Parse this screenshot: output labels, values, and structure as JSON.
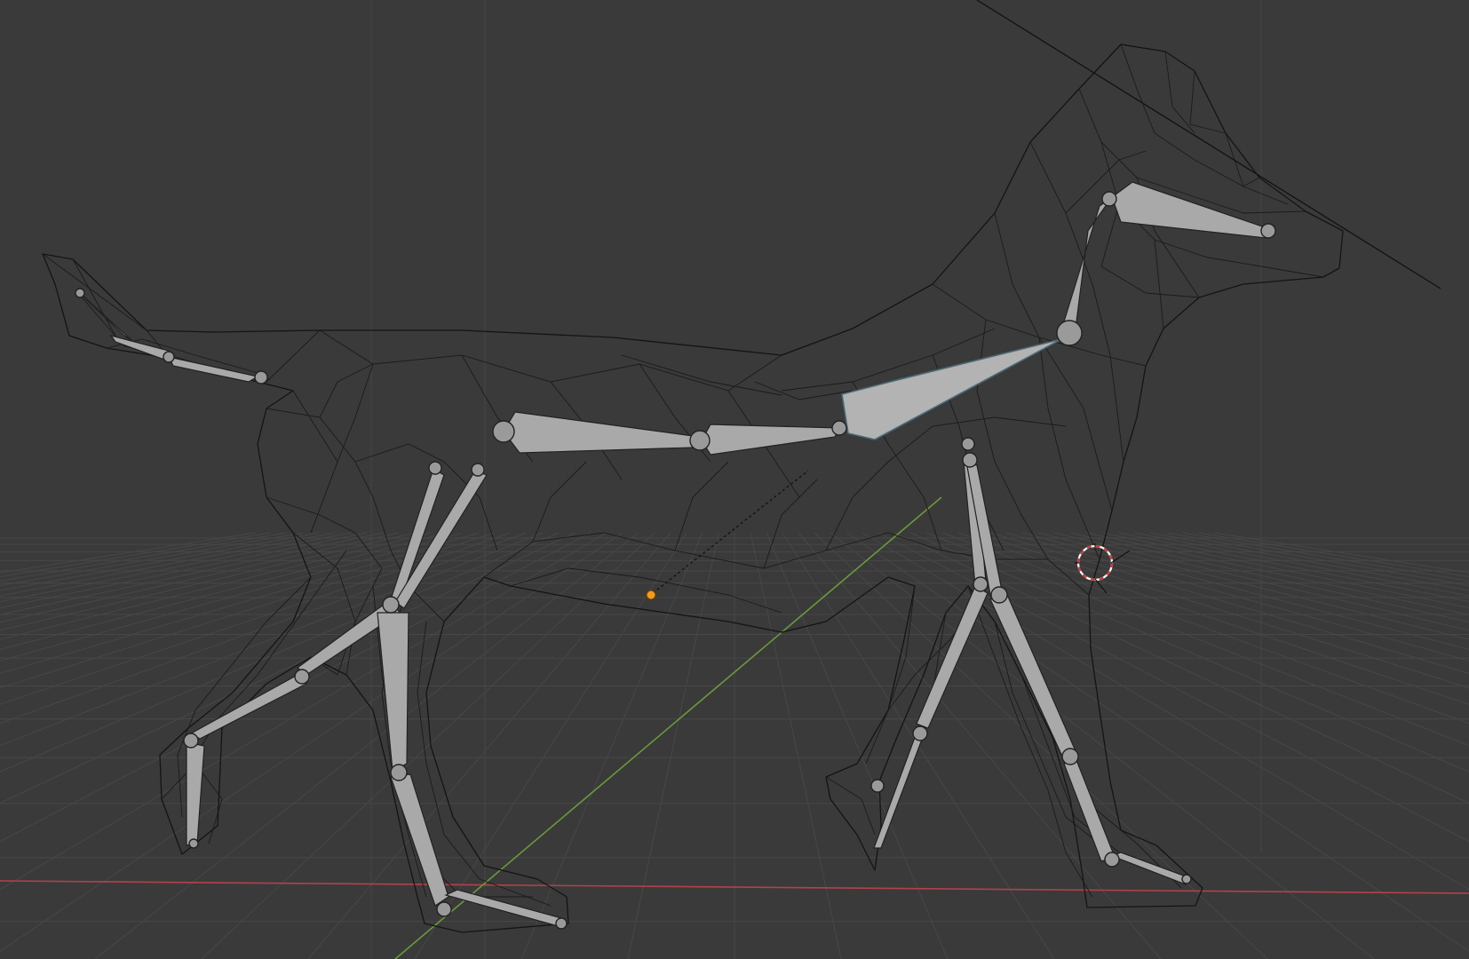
{
  "scene": {
    "background_color": "#3a3a3a",
    "grid_color": "#474747",
    "x_axis_color": "#b3414b",
    "y_axis_color": "#6b9a3a",
    "wireframe_color": "#141414",
    "bone_color": "#a9a9a9",
    "origin_dot_color": "#f29a1a",
    "cursor_color": "#d23b3b"
  },
  "objects": [
    {
      "name": "dog-mesh",
      "kind": "mesh-wireframe"
    },
    {
      "name": "dog-armature",
      "kind": "armature"
    }
  ],
  "icons": [
    "3d-cursor-icon",
    "object-origin-icon"
  ]
}
